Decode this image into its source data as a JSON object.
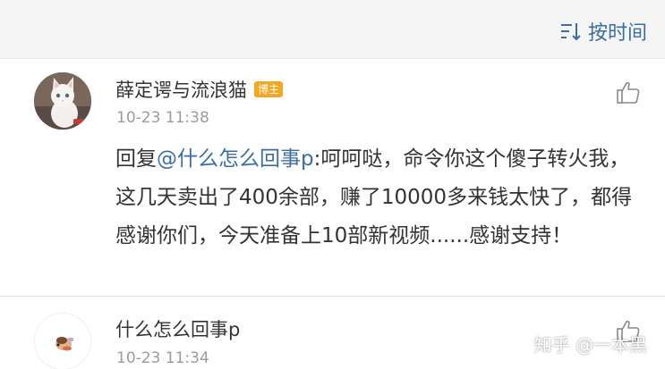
{
  "sort": {
    "label": "按时间",
    "icon": "sort-icon"
  },
  "comments": [
    {
      "username": "薛定谔与流浪猫",
      "badge": "博主",
      "timestamp": "10-23 11:38",
      "avatar_icon": "cat-avatar",
      "like_icon": "thumbs-up-icon",
      "reply_prefix": "回复",
      "mention": "@什么怎么回事p",
      "text": ":呵呵哒，命令你这个傻子转火我，这几天卖出了400余部，赚了10000多来钱太快了，都得感谢你们，今天准备上10部新视频......感谢支持！"
    },
    {
      "username": "什么怎么回事p",
      "timestamp": "10-23 11:34",
      "avatar_icon": "cartoon-avatar",
      "like_icon": "thumbs-up-icon"
    }
  ],
  "watermark": "知乎 @一本黑",
  "colors": {
    "link": "#3a6ea5",
    "badge": "#f5a623",
    "timestamp": "#9b9b9b",
    "text": "#333333"
  }
}
